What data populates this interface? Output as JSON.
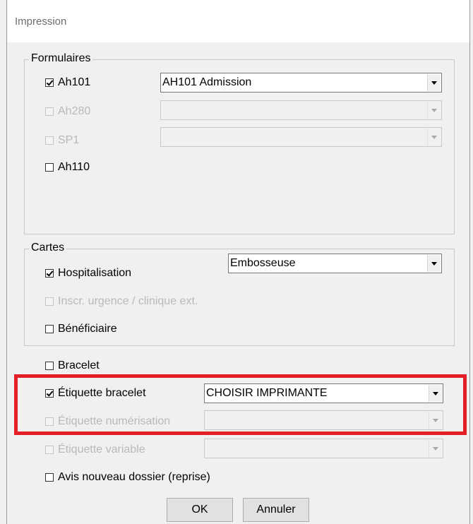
{
  "window": {
    "title": "Impression"
  },
  "formulaires": {
    "label": "Formulaires",
    "items": [
      {
        "label": "Ah101",
        "checked": true,
        "enabled": true,
        "select_value": "AH101 Admission",
        "select_enabled": true
      },
      {
        "label": "Ah280",
        "checked": false,
        "enabled": false,
        "select_value": "",
        "select_enabled": false
      },
      {
        "label": "SP1",
        "checked": false,
        "enabled": false,
        "select_value": "",
        "select_enabled": false
      },
      {
        "label": "Ah110",
        "checked": false,
        "enabled": true
      }
    ]
  },
  "cartes": {
    "label": "Cartes",
    "select_value": "Embosseuse",
    "items": [
      {
        "label": "Hospitalisation",
        "checked": true,
        "enabled": true
      },
      {
        "label": "Inscr. urgence / clinique ext.",
        "checked": false,
        "enabled": false
      },
      {
        "label": "Bénéficiaire",
        "checked": false,
        "enabled": true
      }
    ]
  },
  "options": [
    {
      "label": "Bracelet",
      "checked": false,
      "enabled": true
    },
    {
      "label": "Étiquette bracelet",
      "checked": true,
      "enabled": true,
      "select_value": "CHOISIR IMPRIMANTE",
      "select_enabled": true
    },
    {
      "label": "Étiquette numérisation",
      "checked": false,
      "enabled": false,
      "select_value": "",
      "select_enabled": false
    },
    {
      "label": "Étiquette variable",
      "checked": false,
      "enabled": false,
      "select_value": "",
      "select_enabled": false
    },
    {
      "label": "Avis nouveau dossier (reprise)",
      "checked": false,
      "enabled": true
    }
  ],
  "buttons": {
    "ok": "OK",
    "cancel": "Annuler"
  },
  "colors": {
    "highlight": "#e21f26",
    "disabled_text": "#b9b9b9"
  }
}
